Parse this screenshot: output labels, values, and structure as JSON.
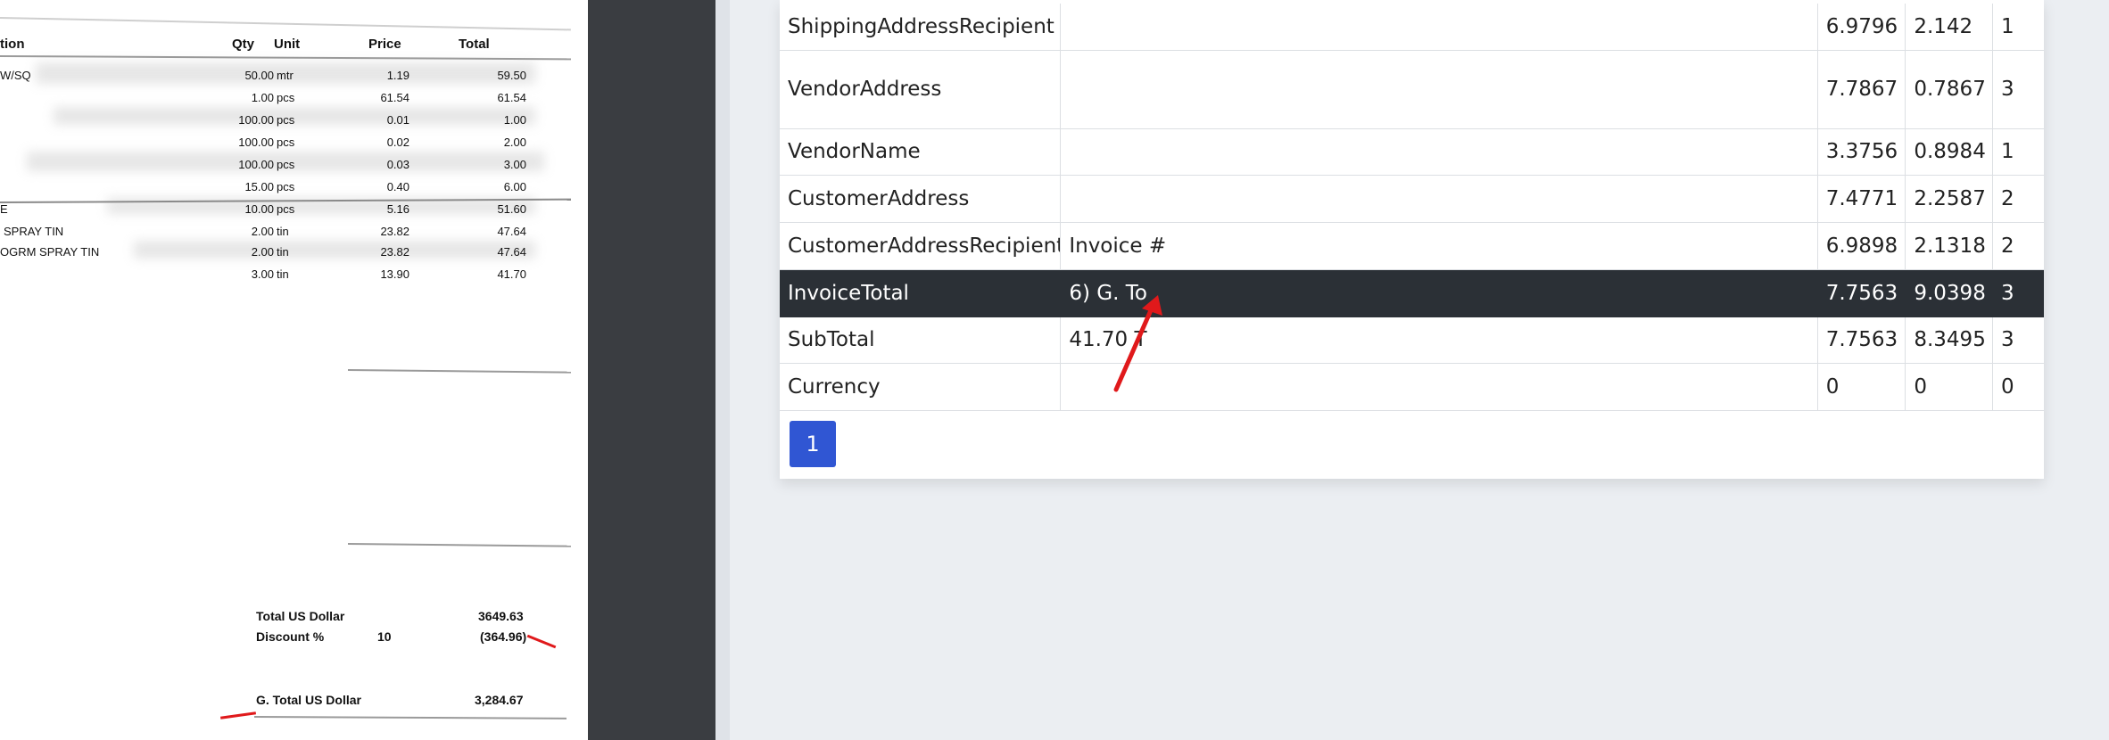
{
  "document": {
    "headers": {
      "description": "tion",
      "qty": "Qty",
      "unit": "Unit",
      "price": "Price",
      "total": "Total"
    },
    "rows": [
      {
        "desc": "W/SQ",
        "qty": "50.00",
        "unit": "mtr",
        "price": "1.19",
        "total": "59.50"
      },
      {
        "desc": "",
        "qty": "1.00",
        "unit": "pcs",
        "price": "61.54",
        "total": "61.54"
      },
      {
        "desc": "",
        "qty": "100.00",
        "unit": "pcs",
        "price": "0.01",
        "total": "1.00"
      },
      {
        "desc": "",
        "qty": "100.00",
        "unit": "pcs",
        "price": "0.02",
        "total": "2.00"
      },
      {
        "desc": "",
        "qty": "100.00",
        "unit": "pcs",
        "price": "0.03",
        "total": "3.00"
      },
      {
        "desc": "",
        "qty": "15.00",
        "unit": "pcs",
        "price": "0.40",
        "total": "6.00"
      },
      {
        "desc": "E",
        "qty": "10.00",
        "unit": "pcs",
        "price": "5.16",
        "total": "51.60"
      },
      {
        "desc": "SPRAY TIN",
        "qty": "2.00",
        "unit": "tin",
        "price": "23.82",
        "total": "47.64"
      },
      {
        "desc": "OGRM SPRAY TIN",
        "qty": "2.00",
        "unit": "tin",
        "price": "23.82",
        "total": "47.64"
      },
      {
        "desc": "",
        "qty": "3.00",
        "unit": "tin",
        "price": "13.90",
        "total": "41.70"
      }
    ],
    "summary": {
      "total_label": "Total US Dollar",
      "total_value": "3649.63",
      "discount_label": "Discount %",
      "discount_rate": "10",
      "discount_value": "(364.96)",
      "grand_label": "G. Total US Dollar",
      "grand_value": "3,284.67"
    }
  },
  "fields": {
    "rows": [
      {
        "name": "ShippingAddressRecipient",
        "value": "",
        "a": "6.9796",
        "b": "2.142",
        "c": "1"
      },
      {
        "name": "VendorAddress",
        "value": "",
        "a": "7.7867",
        "b": "0.7867",
        "c": "3"
      },
      {
        "name": "VendorName",
        "value": "",
        "a": "3.3756",
        "b": "0.8984",
        "c": "1"
      },
      {
        "name": "CustomerAddress",
        "value": "",
        "a": "7.4771",
        "b": "2.2587",
        "c": "2"
      },
      {
        "name": "CustomerAddressRecipient",
        "value": "Invoice #",
        "a": "6.9898",
        "b": "2.1318",
        "c": "2"
      },
      {
        "name": "InvoiceTotal",
        "value": "6) G. To",
        "a": "7.7563",
        "b": "9.0398",
        "c": "3"
      },
      {
        "name": "SubTotal",
        "value": "41.70 T",
        "a": "7.7563",
        "b": "8.3495",
        "c": "3"
      },
      {
        "name": "Currency",
        "value": "",
        "a": "0",
        "b": "0",
        "c": "0"
      }
    ],
    "selected_row": "InvoiceTotal"
  },
  "pagination": {
    "current_page": "1"
  },
  "colors": {
    "selected_row": "#2b3036",
    "page_button": "#3056d3",
    "annotation": "#e0191b"
  }
}
